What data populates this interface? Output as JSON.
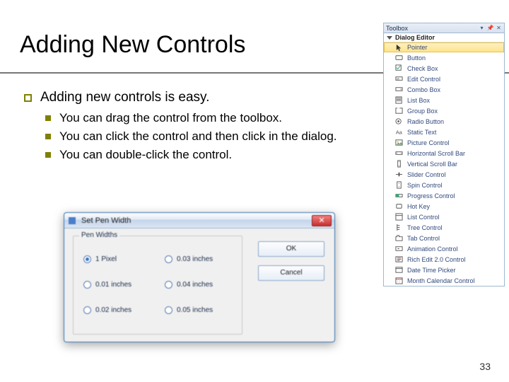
{
  "title": "Adding New Controls",
  "page_number": "33",
  "bullet_main": "Adding new controls is easy.",
  "sub_bullets": [
    "You can drag the control from the toolbox.",
    "You can click the control and then click in the dialog.",
    "You can double-click the control."
  ],
  "toolbox": {
    "title": "Toolbox",
    "section": "Dialog Editor",
    "items": [
      "Pointer",
      "Button",
      "Check Box",
      "Edit Control",
      "Combo Box",
      "List Box",
      "Group Box",
      "Radio Button",
      "Static Text",
      "Picture Control",
      "Horizontal Scroll Bar",
      "Vertical Scroll Bar",
      "Slider Control",
      "Spin Control",
      "Progress Control",
      "Hot Key",
      "List Control",
      "Tree Control",
      "Tab Control",
      "Animation Control",
      "Rich Edit 2.0 Control",
      "Date Time Picker",
      "Month Calendar Control"
    ]
  },
  "dialog": {
    "title": "Set Pen Width",
    "group": "Pen Widths",
    "radios": [
      "1 Pixel",
      "0.03 inches",
      "0.01 inches",
      "0.04 inches",
      "0.02 inches",
      "0.05 inches"
    ],
    "selected": 0,
    "ok": "OK",
    "cancel": "Cancel"
  }
}
